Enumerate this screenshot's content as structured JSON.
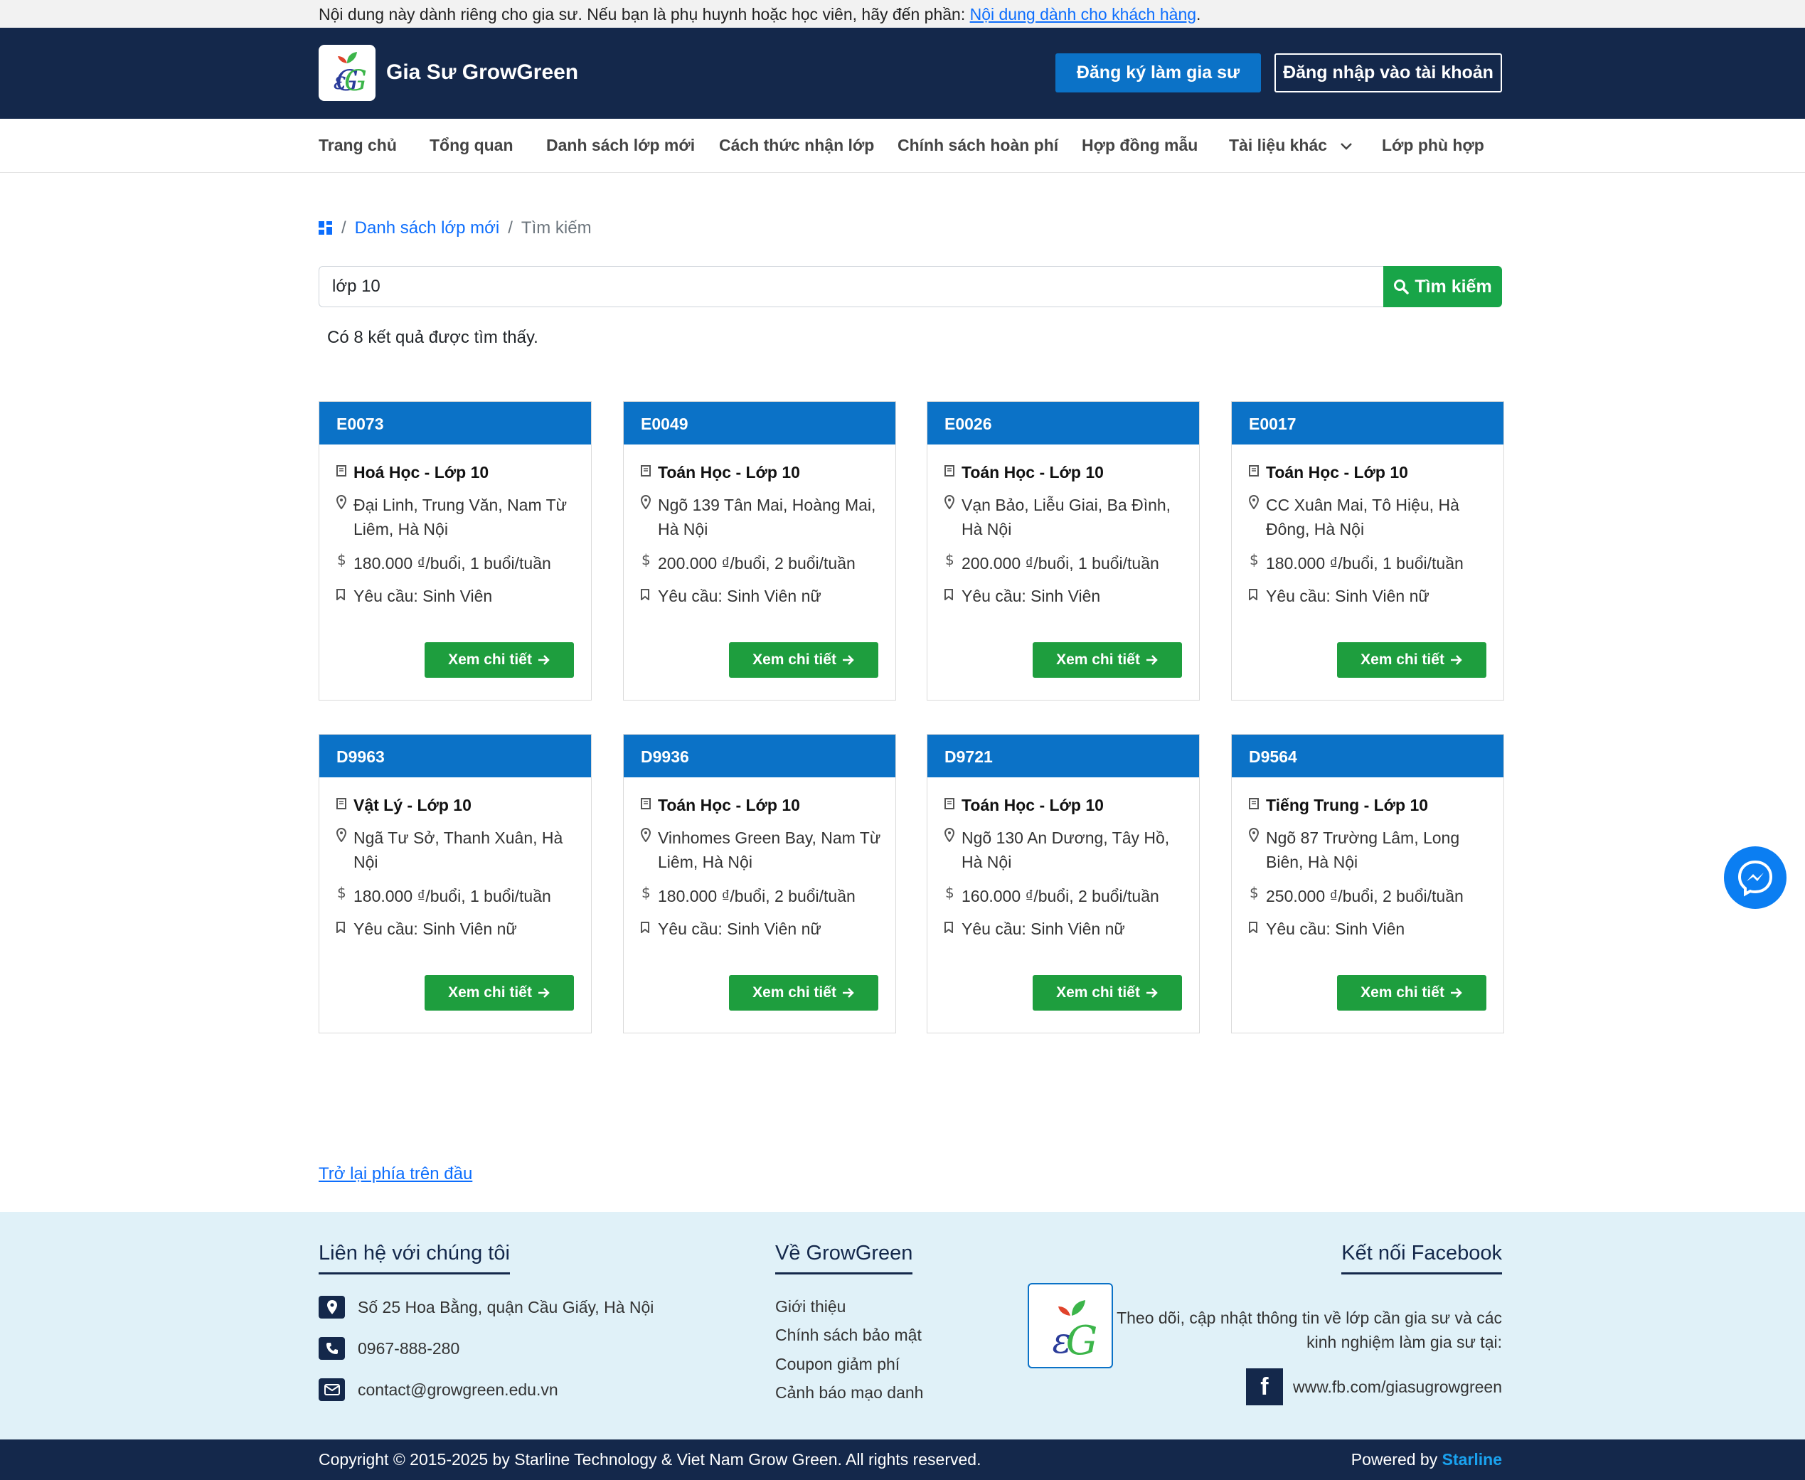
{
  "notice": {
    "text": "Nội dung này dành riêng cho gia sư. Nếu bạn là phụ huynh hoặc học viên, hãy đến phần:",
    "link": "Nội dung dành cho khách hàng"
  },
  "header": {
    "brand": "Gia Sư GrowGreen",
    "register_label": "Đăng ký làm gia sư",
    "login_label": "Đăng nhập vào tài khoản"
  },
  "menu": [
    "Trang chủ",
    "Tổng quan",
    "Danh sách lớp mới",
    "Cách thức nhận lớp",
    "Chính sách hoàn phí",
    "Hợp đồng mẫu",
    "Tài liệu khác",
    "Lớp phù hợp"
  ],
  "breadcrumb": {
    "sep": "/",
    "link": "Danh sách lớp mới",
    "current": "Tìm kiếm"
  },
  "search": {
    "value": "lớp 10",
    "button": "Tìm kiếm"
  },
  "result_text": "Có 8 kết quả được tìm thấy.",
  "cards": [
    {
      "code": "E0073",
      "subject": "Hoá Học - Lớp 10",
      "address": "Đại Linh, Trung Văn, Nam Từ Liêm, Hà Nội",
      "fee": "180.000 ₫/buổi, 1 buổi/tuần",
      "require": "Yêu cầu: Sinh Viên",
      "button": "Xem chi tiết"
    },
    {
      "code": "E0049",
      "subject": "Toán Học - Lớp 10",
      "address": "Ngõ 139 Tân Mai, Hoàng Mai, Hà Nội",
      "fee": "200.000 ₫/buổi, 2 buổi/tuần",
      "require": "Yêu cầu: Sinh Viên nữ",
      "button": "Xem chi tiết"
    },
    {
      "code": "E0026",
      "subject": "Toán Học - Lớp 10",
      "address": "Vạn Bảo, Liễu Giai, Ba Đình, Hà Nội",
      "fee": "200.000 ₫/buổi, 1 buổi/tuần",
      "require": "Yêu cầu: Sinh Viên",
      "button": "Xem chi tiết"
    },
    {
      "code": "E0017",
      "subject": "Toán Học - Lớp 10",
      "address": "CC Xuân Mai, Tô Hiệu, Hà Đông, Hà Nội",
      "fee": "180.000 ₫/buổi, 1 buổi/tuần",
      "require": "Yêu cầu: Sinh Viên nữ",
      "button": "Xem chi tiết"
    },
    {
      "code": "D9963",
      "subject": "Vật Lý - Lớp 10",
      "address": "Ngã Tư Sở, Thanh Xuân, Hà Nội",
      "fee": "180.000 ₫/buổi, 1 buổi/tuần",
      "require": "Yêu cầu: Sinh Viên nữ",
      "button": "Xem chi tiết"
    },
    {
      "code": "D9936",
      "subject": "Toán Học - Lớp 10",
      "address": "Vinhomes Green Bay, Nam Từ Liêm, Hà Nội",
      "fee": "180.000 ₫/buổi, 2 buổi/tuần",
      "require": "Yêu cầu: Sinh Viên nữ",
      "button": "Xem chi tiết"
    },
    {
      "code": "D9721",
      "subject": "Toán Học - Lớp 10",
      "address": "Ngõ 130 An Dương, Tây Hồ, Hà Nội",
      "fee": "160.000 ₫/buổi, 2 buổi/tuần",
      "require": "Yêu cầu: Sinh Viên nữ",
      "button": "Xem chi tiết"
    },
    {
      "code": "D9564",
      "subject": "Tiếng Trung - Lớp 10",
      "address": "Ngõ 87 Trường Lâm, Long Biên, Hà Nội",
      "fee": "250.000 ₫/buổi, 2 buổi/tuần",
      "require": "Yêu cầu: Sinh Viên",
      "button": "Xem chi tiết"
    }
  ],
  "back_to_top": "Trở lại phía trên đầu",
  "footer": {
    "contact_title": "Liên hệ với chúng tôi",
    "address": "Số 25 Hoa Bằng, quận Cầu Giấy, Hà Nội",
    "phone": "0967-888-280",
    "email": "contact@growgreen.edu.vn",
    "about_title": "Về GrowGreen",
    "about_links": [
      "Giới thiệu",
      "Chính sách bảo mật",
      "Coupon giảm phí",
      "Cảnh báo mạo danh"
    ],
    "fb_title": "Kết nối Facebook",
    "fb_desc": "Theo dõi, cập nhật thông tin về lớp cần gia sư và các kinh nghiệm làm gia sư tại:",
    "fb_link": "www.fb.com/giasugrowgreen"
  },
  "copyright": {
    "text": "Copyright © 2015-2025 by Starline Technology & Viet Nam Grow Green. All rights reserved.",
    "powered": "Powered by",
    "powered_brand": "Starline"
  },
  "colors": {
    "navy": "#14284b",
    "blue": "#0b72c7",
    "green": "#18a548",
    "footer_bg": "#e0f1f8"
  }
}
